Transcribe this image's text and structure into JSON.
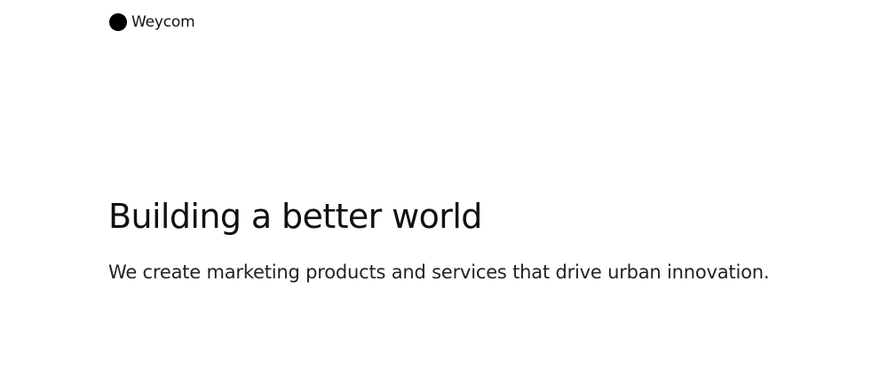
{
  "header": {
    "brand_name": "Weycom",
    "logo_icon": "filled-circle-logo-icon",
    "logo_color": "#000000"
  },
  "hero": {
    "title": "Building a better world",
    "subtitle": "We create marketing products and services that drive urban innovation."
  },
  "colors": {
    "background": "#ffffff",
    "text": "#111111"
  }
}
